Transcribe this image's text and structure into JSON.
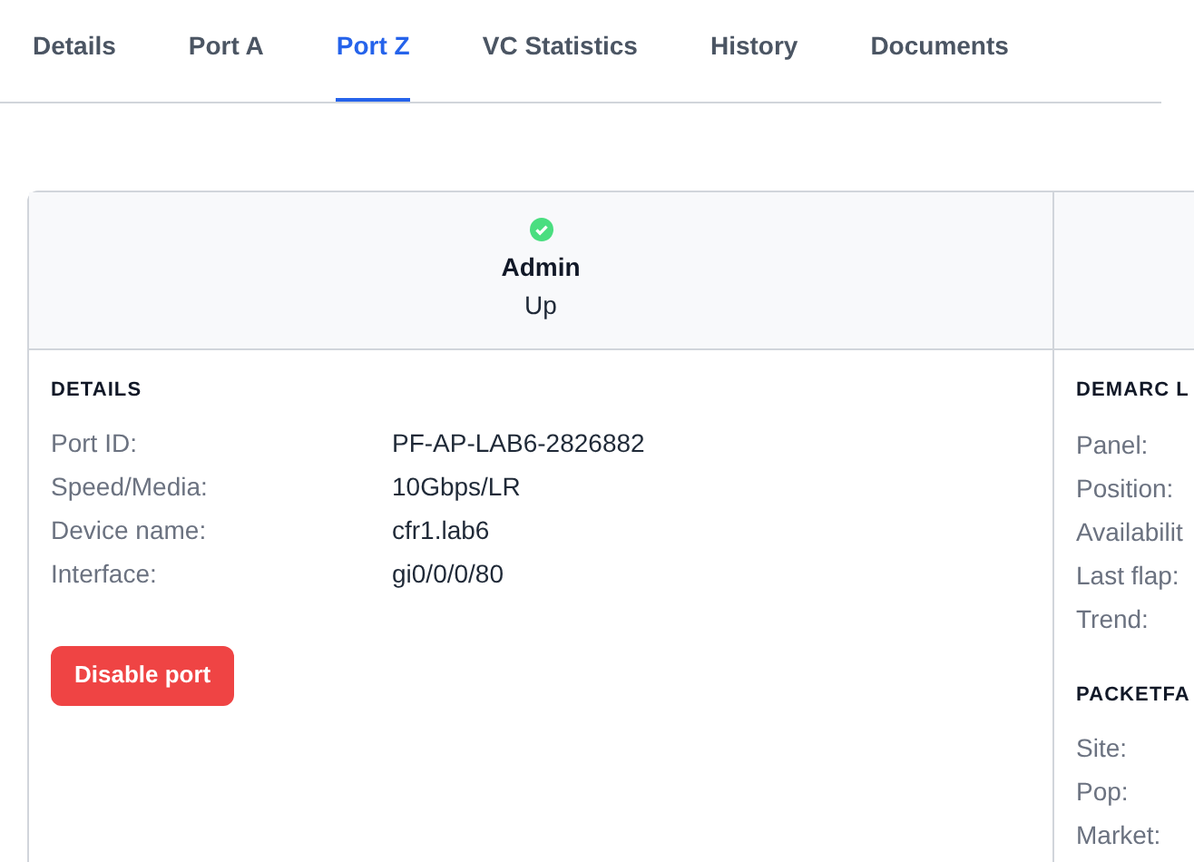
{
  "tabs": [
    {
      "label": "Details",
      "selected": false
    },
    {
      "label": "Port A",
      "selected": false
    },
    {
      "label": "Port Z",
      "selected": true
    },
    {
      "label": "VC Statistics",
      "selected": false
    },
    {
      "label": "History",
      "selected": false
    },
    {
      "label": "Documents",
      "selected": false
    }
  ],
  "status": {
    "title": "Admin",
    "value": "Up",
    "ok": true
  },
  "details": {
    "heading": "DETAILS",
    "rows": [
      {
        "label": "Port ID:",
        "value": "PF-AP-LAB6-2826882"
      },
      {
        "label": "Speed/Media:",
        "value": "10Gbps/LR"
      },
      {
        "label": "Device name:",
        "value": "cfr1.lab6"
      },
      {
        "label": "Interface:",
        "value": "gi0/0/0/80"
      }
    ],
    "button": "Disable port"
  },
  "side_sections": [
    {
      "heading": "DEMARC L",
      "labels": [
        "Panel:",
        "Position:",
        "Availabilit",
        "Last flap:",
        "Trend:"
      ]
    },
    {
      "heading": "PACKETFA",
      "labels": [
        "Site:",
        "Pop:",
        "Market:"
      ]
    }
  ]
}
